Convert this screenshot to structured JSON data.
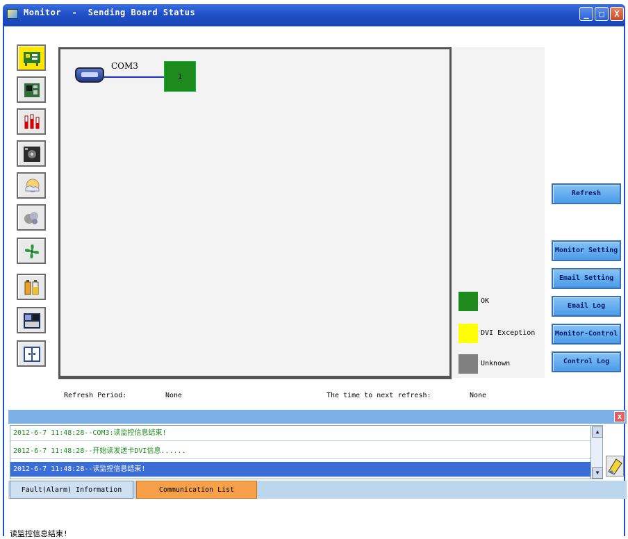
{
  "window": {
    "title": "Monitor  -  Sending Board Status",
    "minimize": "_",
    "maximize": "□",
    "close": "X"
  },
  "topology": {
    "port_label": "COM3",
    "board_number": "1"
  },
  "legend": [
    {
      "label": "OK",
      "color": "#1e8a1e"
    },
    {
      "label": "DVI Exception",
      "color": "#ffff00"
    },
    {
      "label": "Unknown",
      "color": "#808080"
    }
  ],
  "buttons": {
    "refresh": "Refresh",
    "monitor_setting": "Monitor Setting",
    "email_setting": "Email Setting",
    "email_log": "Email Log",
    "monitor_control": "Monitor-Control",
    "control_log": "Control Log"
  },
  "refresh_info": {
    "period_label": "Refresh Period:",
    "period_value": "None",
    "next_label": "The time to next refresh:",
    "next_value": "None"
  },
  "log": {
    "close": "x",
    "entries": [
      "2012-6-7 11:48:28--COM3:读监控信息结束!",
      "2012-6-7 11:48:28--开始读发送卡DVI信息......",
      "2012-6-7 11:48:28--读监控信息结束!"
    ]
  },
  "tabs": {
    "fault": "Fault(Alarm) Information",
    "communication": "Communication List"
  },
  "status_bar": "读监控信息结束!"
}
